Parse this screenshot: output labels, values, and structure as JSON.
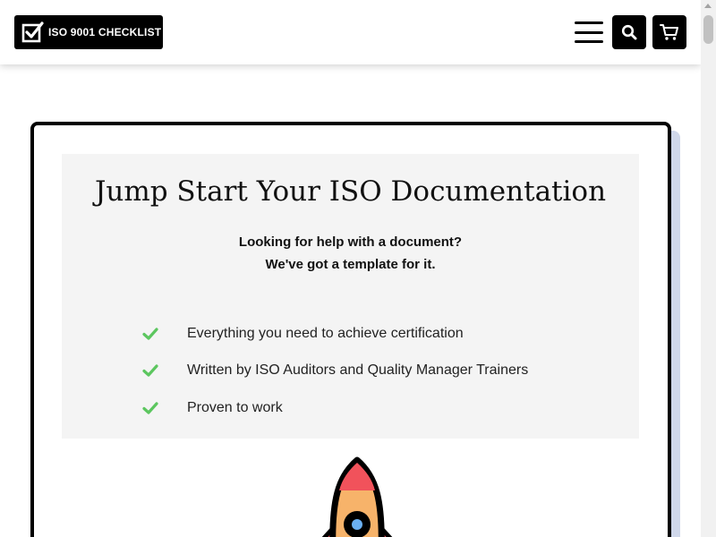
{
  "header": {
    "logo_text": "ISO 9001 CHECKLIST",
    "menu_icon": "hamburger-menu-icon",
    "search_icon": "search-icon",
    "cart_icon": "shopping-cart-icon"
  },
  "hero": {
    "title": "Jump Start Your ISO Documentation",
    "subtitle_line1": "Looking for help with a document?",
    "subtitle_line2": "We've got a template for it.",
    "features": [
      "Everything you need to achieve certification",
      "Written by ISO Auditors and Quality Manager Trainers",
      "Proven to work"
    ],
    "feature_icon": "check-icon",
    "illustration": "rocket-icon"
  },
  "colors": {
    "accent_check": "#5cc65f",
    "card_shadow": "#cfd7ea",
    "panel_bg": "#f4f4f4",
    "rocket_red": "#f1525b",
    "rocket_orange": "#f7b36a",
    "rocket_window": "#6ab0f3"
  }
}
